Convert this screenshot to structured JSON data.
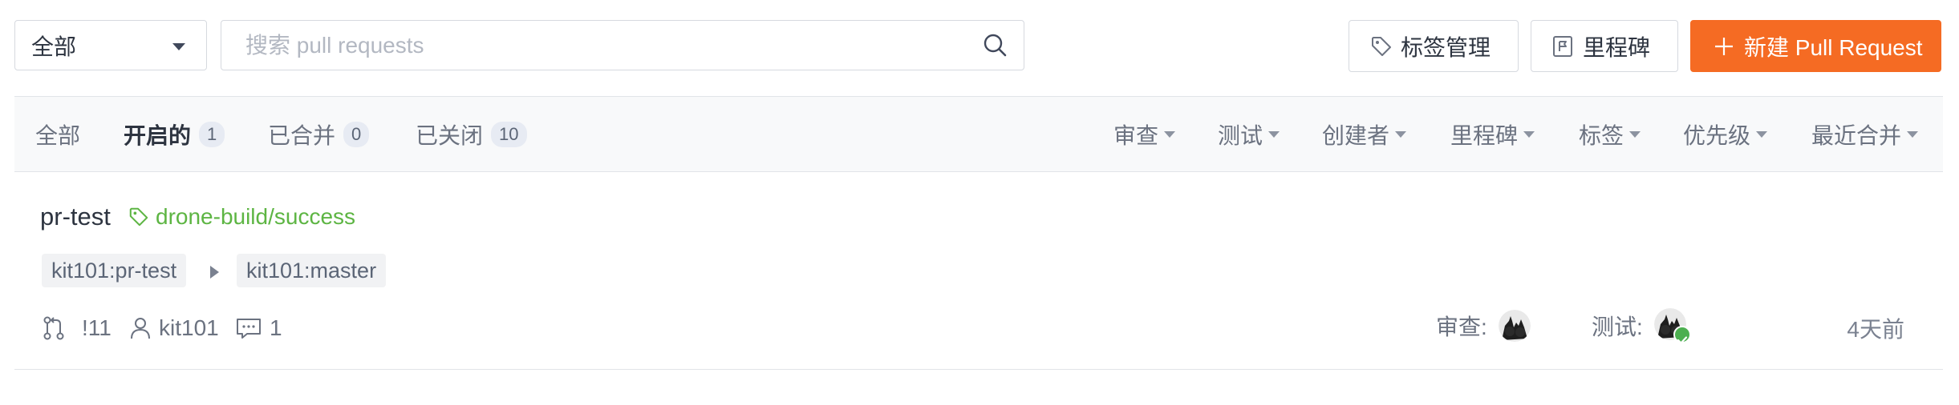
{
  "toolbar": {
    "scope_select": "全部",
    "search_placeholder": "搜索 pull requests",
    "search_value": "",
    "labels_button": "标签管理",
    "milestone_button": "里程碑",
    "new_pr_button": "新建 Pull Request"
  },
  "tabs": [
    {
      "label": "全部"
    },
    {
      "label": "开启的",
      "count": "1",
      "active": true
    },
    {
      "label": "已合并",
      "count": "0"
    },
    {
      "label": "已关闭",
      "count": "10"
    }
  ],
  "filters": {
    "review": "审查",
    "test": "测试",
    "creator": "创建者",
    "milestone": "里程碑",
    "label": "标签",
    "priority": "优先级",
    "sort": "最近合并"
  },
  "pull_requests": [
    {
      "title": "pr-test",
      "label": "drone-build/success",
      "source_branch": "kit101:pr-test",
      "target_branch": "kit101:master",
      "number": "!11",
      "author": "kit101",
      "comments": "1",
      "review_label": "审查:",
      "test_label": "测试:",
      "time": "4天前"
    }
  ],
  "colors": {
    "accent": "#f56b23",
    "label_green": "#5db543",
    "check_green": "#4caf50"
  },
  "icons": [
    "chevron-down-icon",
    "search-icon",
    "tag-icon",
    "milestone-icon",
    "plus-icon",
    "pull-request-icon",
    "user-icon",
    "comment-icon",
    "check-icon"
  ]
}
